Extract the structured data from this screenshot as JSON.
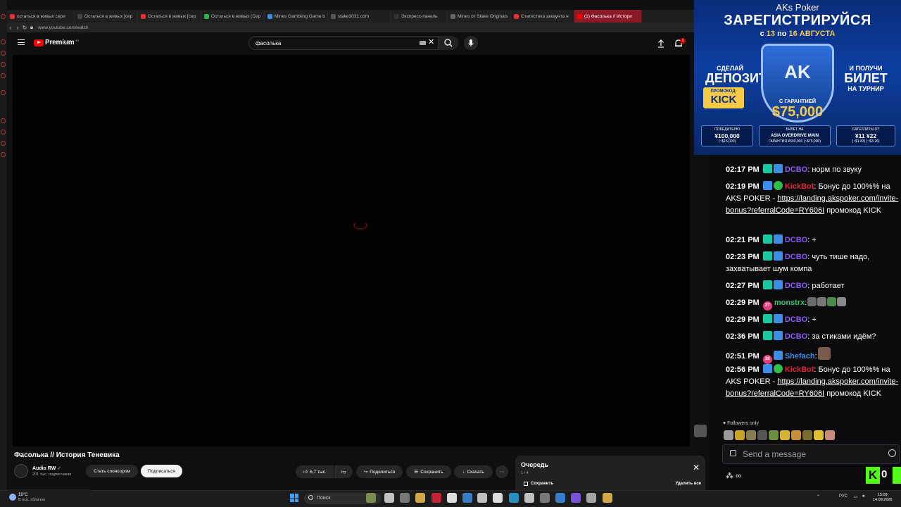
{
  "browser": {
    "tabs": [
      {
        "label": "остаться в живых сери",
        "color": "#d33"
      },
      {
        "label": "Остаться в живых [сер",
        "color": "#444"
      },
      {
        "label": "Остаться в живых [сер",
        "color": "#d33"
      },
      {
        "label": "Остаться в живых (Сер",
        "color": "#2bb24c"
      },
      {
        "label": "Mines Gambling Game b",
        "color": "#3a8ee8"
      },
      {
        "label": "stake3031.com",
        "color": "#555"
      },
      {
        "label": "Экспресс-панель",
        "color": "#333"
      },
      {
        "label": "Mines от Stake Originals",
        "color": "#666"
      },
      {
        "label": "Статистика аккаунта н",
        "color": "#d33"
      },
      {
        "label": "(1) Фасолька // Истори",
        "color": "#ff0000"
      }
    ],
    "url": "www.youtube.com/watch"
  },
  "youtube": {
    "logo_text": "Premium",
    "logo_sup": "HR",
    "search_value": "фасолька",
    "notification_count": "1",
    "video_title": "Фасолька // История Теневика",
    "channel_name": "Audio RW",
    "channel_subs": "201 тыс. подписчиков",
    "sponsor_label": "Стать спонсором",
    "subscribe_label": "Подписаться",
    "likes_label": "6,7 тыс.",
    "share_label": "Поделиться",
    "save_label": "Сохранить",
    "download_label": "Скачать",
    "queue": {
      "title": "Очередь",
      "count": "1 / 4",
      "save_label": "Сохранить",
      "delete_label": "Удалить все"
    }
  },
  "ad": {
    "brand": "AKs Poker",
    "headline": "ЗАРЕГИСТРИРУЙСЯ",
    "dates_prefix": "с",
    "date_from": "13",
    "dates_mid": "по",
    "date_to": "16 АВГУСТА",
    "left_top": "СДЕЛАЙ",
    "left_big": "ДЕПОЗИТ",
    "promo_label": "ПРОМОКОД:",
    "promo_code": "KICK",
    "right_top": "И ПОЛУЧИ",
    "right_big": "БИЛЕТ",
    "right_bottom": "НА ТУРНИР",
    "shield_logo": "AK",
    "guarantee": "С ГАРАНТИЕЙ",
    "prize": "$75,000",
    "box1_top": "ПОБЕДИТЕЛЮ",
    "box1_big": "¥100,000",
    "box1_sub": "(~$15,000)",
    "box2_top": "БИЛЕТ НА",
    "box2_big": "ASIA OVERDRIVE MAIN",
    "box2_sub": "ГАРАНТИЯ ¥500,000 (~$75,000)",
    "box3_top": "САТЕЛЛИТЫ ОТ",
    "box3_big": "¥11   ¥22",
    "box3_sub": "(~$1.83)   (~$3.26)"
  },
  "chat": {
    "messages": [
      {
        "time": "02:17 PM",
        "user": "DCBO",
        "text": ": норм по звуку"
      },
      {
        "time": "02:19 PM",
        "user": "KickBot",
        "text": ": Бонус до 100%% на AKS POKER - ",
        "link": "https://landing.akspoker.com/invite-bonus?referralCode=RY606I",
        "after": " промокод KICK"
      },
      {
        "time": "02:21 PM",
        "user": "DCBO",
        "text": ": +"
      },
      {
        "time": "02:23 PM",
        "user": "DCBO",
        "text": ": чуть тише надо, захватывает шум компа"
      },
      {
        "time": "02:27 PM",
        "user": "DCBO",
        "text": ": работает"
      },
      {
        "time": "02:29 PM",
        "user": "monstrx",
        "badge": "27",
        "text": ":"
      },
      {
        "time": "02:29 PM",
        "user": "DCBO",
        "text": ": +"
      },
      {
        "time": "02:36 PM",
        "user": "DCBO",
        "text": ": за стиками идём?"
      },
      {
        "time": "02:51 PM",
        "user": "Shefach",
        "badge": "28",
        "text": ":"
      },
      {
        "time": "02:56 PM",
        "user": "KickBot",
        "text": ": Бонус до 100%% на AKS POKER - ",
        "link": "https://landing.akspoker.com/invite-bonus?referralCode=RY606I",
        "after": " промокод KICK"
      }
    ],
    "followers_only": "Followers only",
    "input_placeholder": "Send a message",
    "footer_symbol": "∞",
    "kick_count": "0",
    "kick_letter": "K"
  },
  "taskbar": {
    "temperature": "16°C",
    "weather": "В осн. облачно",
    "search_label": "Поиск",
    "language": "РУС",
    "time": "15:09",
    "date": "14.08.2026"
  }
}
